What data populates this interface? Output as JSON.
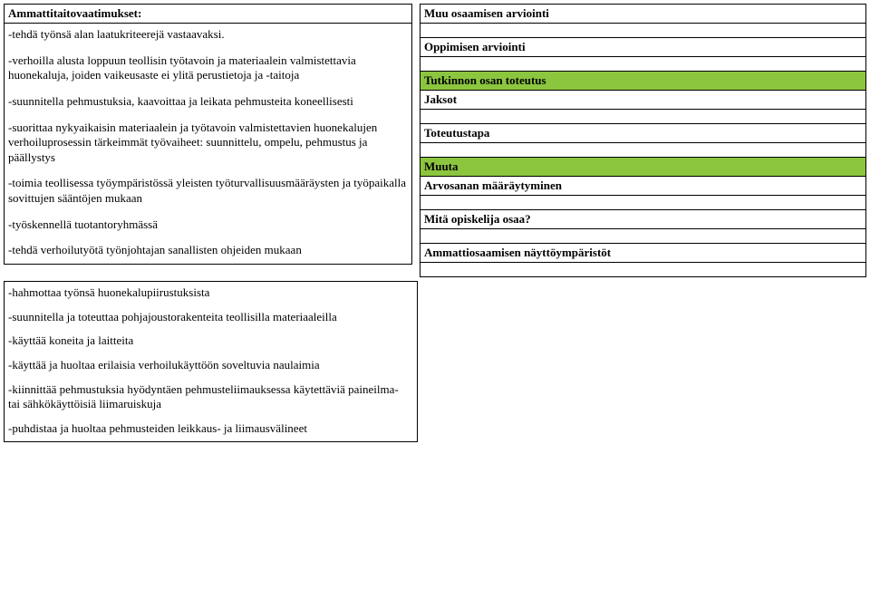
{
  "left": {
    "heading": "Ammattitaitovaatimukset:",
    "paragraphs": [
      "-tehdä työnsä alan laatukriteerejä vastaavaksi.",
      "-verhoilla alusta loppuun teollisin työtavoin ja materiaalein valmistettavia huonekaluja, joiden vaikeusaste ei ylitä perustietoja ja -taitoja",
      "-suunnitella pehmustuksia, kaavoittaa ja leikata pehmusteita koneellisesti",
      "-suorittaa nykyaikaisin materiaalein ja työtavoin valmistettavien huonekalujen verhoiluprosessin tärkeimmät työvaiheet: suunnittelu, ompelu, pehmustus ja päällystys",
      "-toimia teollisessa työympäristössä yleisten työturvallisuusmääräysten ja työpaikalla sovittujen sääntöjen mukaan",
      "-työskennellä tuotantoryhmässä",
      "-tehdä verhoilutyötä työnjohtajan sanallisten ohjeiden mukaan",
      "-hahmottaa työnsä huonekalupiirustuksista",
      "-suunnitella ja toteuttaa pohjajoustorakenteita teollisilla materiaaleilla",
      "-käyttää koneita ja laitteita",
      "-käyttää ja huoltaa erilaisia verhoilukäyttöön soveltuvia naulaimia",
      "-kiinnittää pehmustuksia hyödyntäen pehmusteliimauksessa käytettäviä paineilma- tai sähkökäyttöisiä liimaruiskuja",
      "-puhdistaa ja huoltaa pehmusteiden leikkaus- ja liimausvälineet"
    ]
  },
  "right": {
    "h1": "Muu osaamisen arviointi",
    "h2": "Oppimisen arviointi",
    "h3": "Tutkinnon osan toteutus",
    "h4": "Jaksot",
    "h5": "Toteutustapa",
    "h6": "Muuta",
    "h7": "Arvosanan määräytyminen",
    "h8": "Mitä opiskelija osaa?",
    "h9": "Ammattiosaamisen näyttöympäristöt"
  }
}
